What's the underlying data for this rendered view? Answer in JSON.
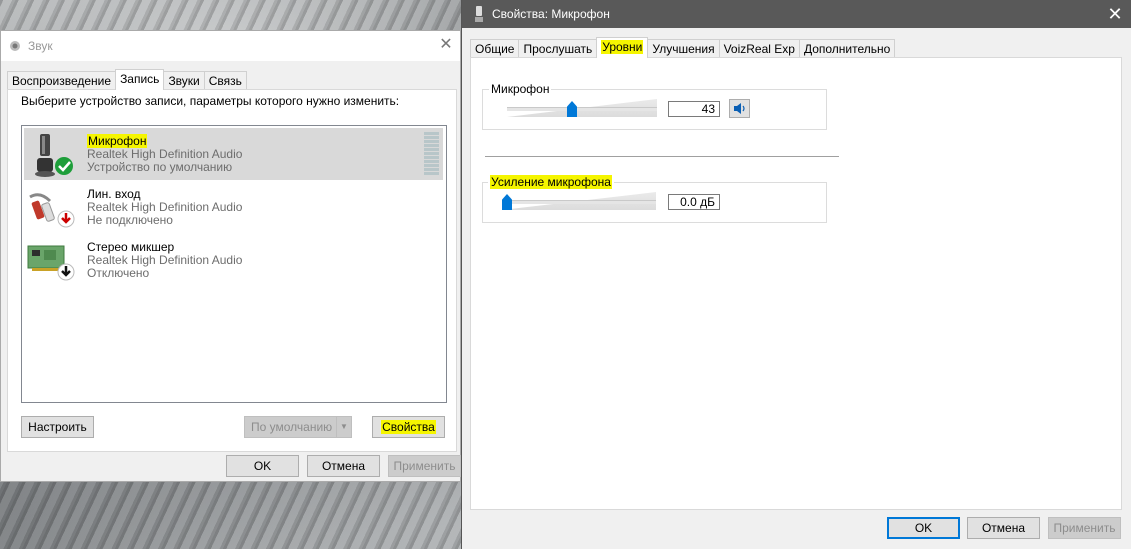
{
  "sound_dialog": {
    "title": "Звук",
    "tabs": [
      "Воспроизведение",
      "Запись",
      "Звуки",
      "Связь"
    ],
    "active_tab": "Запись",
    "instruction": "Выберите устройство записи, параметры которого нужно изменить:",
    "devices": [
      {
        "name": "Микрофон",
        "driver": "Realtek High Definition Audio",
        "status": "Устройство по умолчанию",
        "icon": "microphone-icon",
        "badge": "green-check-icon",
        "selected": true
      },
      {
        "name": "Лин. вход",
        "driver": "Realtek High Definition Audio",
        "status": "Не подключено",
        "icon": "line-in-icon",
        "badge": "red-down-arrow-icon",
        "selected": false
      },
      {
        "name": "Стерео микшер",
        "driver": "Realtek High Definition Audio",
        "status": "Отключено",
        "icon": "sound-card-icon",
        "badge": "black-down-arrow-icon",
        "selected": false
      }
    ],
    "buttons": {
      "configure": "Настроить",
      "set_default": "По умолчанию",
      "properties": "Свойства",
      "ok": "OK",
      "cancel": "Отмена",
      "apply": "Применить"
    }
  },
  "props_dialog": {
    "title": "Свойства: Микрофон",
    "tabs": [
      "Общие",
      "Прослушать",
      "Уровни",
      "Улучшения",
      "VoizReal Exp",
      "Дополнительно"
    ],
    "active_tab": "Уровни",
    "microphone": {
      "label": "Микрофон",
      "value": "43",
      "level_percent": 43
    },
    "boost": {
      "label": "Усиление микрофона",
      "value": "0.0 дБ",
      "level_percent": 0
    },
    "buttons": {
      "ok": "OK",
      "cancel": "Отмена",
      "apply": "Применить"
    }
  },
  "colors": {
    "highlight": "#f5f500",
    "accent": "#0078d7"
  }
}
